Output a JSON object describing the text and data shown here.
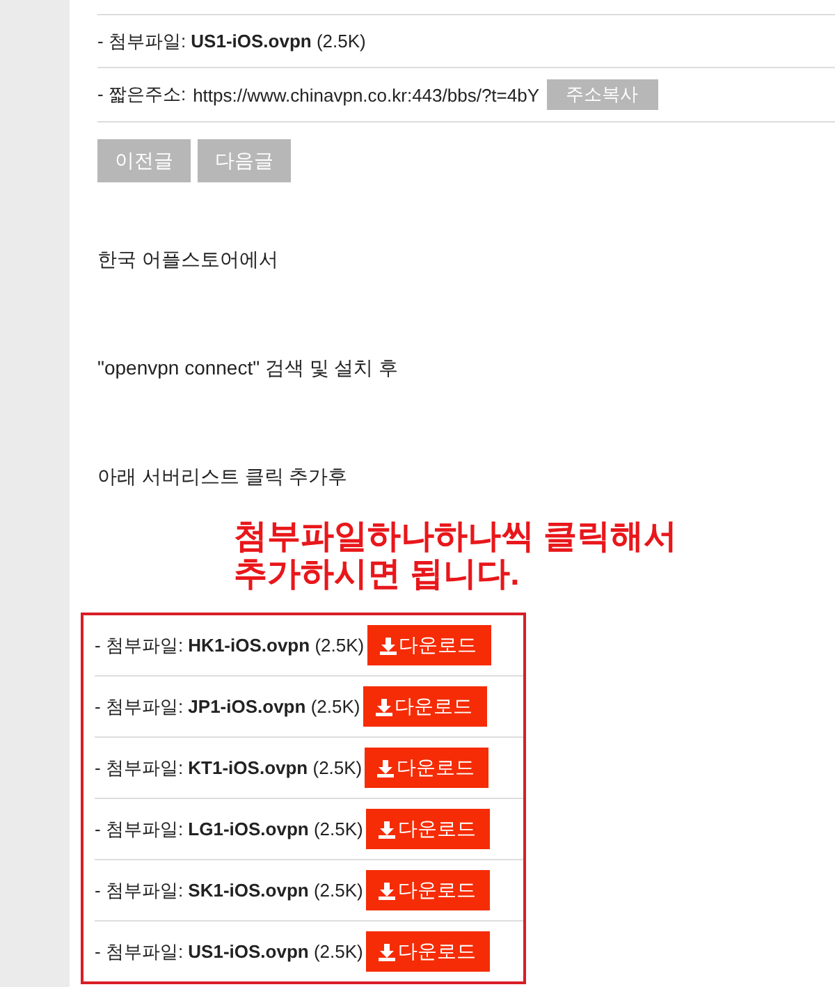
{
  "attachment": {
    "text": "- 첨부파일: **US1-iOS.ovpn** (2.5K)"
  },
  "short_url": {
    "label": "- 짧은주소:",
    "url": "https://www.chinavpn.co.kr:443/bbs/?t=4bY",
    "copy_button": "주소복사"
  },
  "nav_buttons": [
    "이전글",
    "다음글"
  ],
  "paragraphs": [
    "한국 어플스토어에서",
    "\"openvpn connect\" 검색 및 설치 후",
    "아래 서버리스트 클릭 추가후"
  ],
  "annotation": [
    "첨부파일하나하나씩 클릭해서",
    "추가하시면 됩니다."
  ],
  "downloads": [
    {
      "text": "- 첨부파일: **HK1-iOS.ovpn** (2.5K)",
      "button": "다운로드"
    },
    {
      "text": "- 첨부파일: **JP1-iOS.ovpn** (2.5K)",
      "button": "다운로드"
    },
    {
      "text": "- 첨부파일: **KT1-iOS.ovpn** (2.5K)",
      "button": "다운로드"
    },
    {
      "text": "- 첨부파일: **LG1-iOS.ovpn** (2.5K)",
      "button": "다운로드"
    },
    {
      "text": "- 첨부파일: **SK1-iOS.ovpn** (2.5K)",
      "button": "다운로드"
    },
    {
      "text": "- 첨부파일: **US1-iOS.ovpn** (2.5K)",
      "button": "다운로드"
    }
  ]
}
